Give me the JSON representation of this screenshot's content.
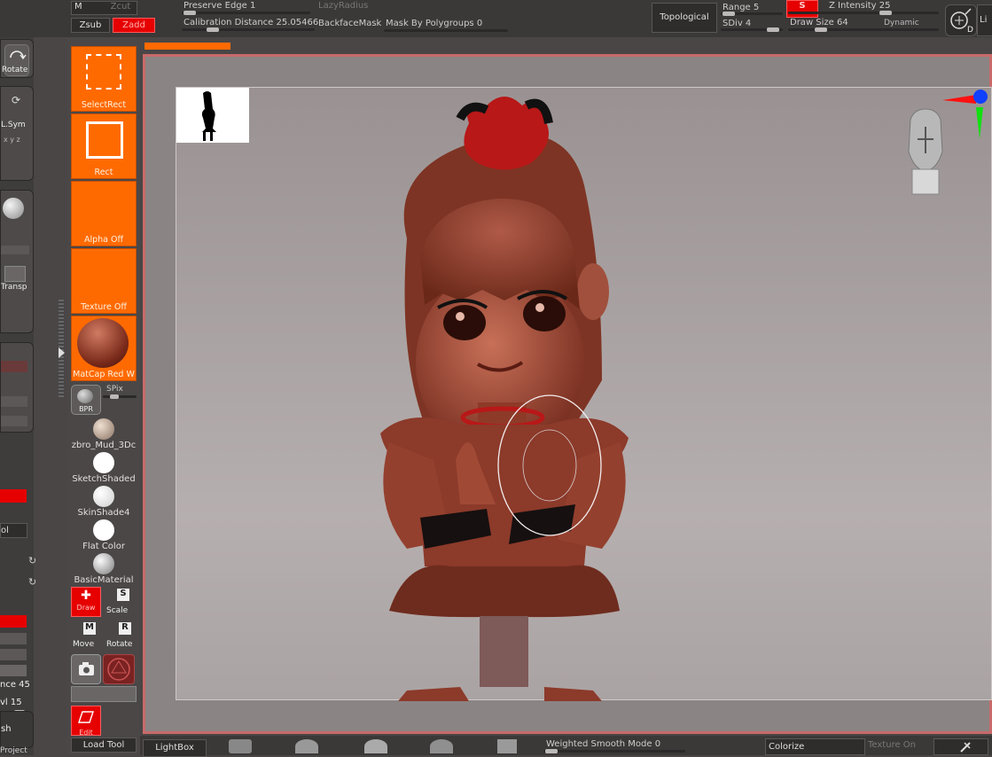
{
  "topbar": {
    "m_label": "M",
    "zcut_label": "Zcut",
    "zsub_label": "Zsub",
    "zadd_label": "Zadd",
    "preserve_edge": "Preserve Edge 1",
    "lazy_radius": "LazyRadius",
    "calibration_distance": "Calibration Distance 25.05466",
    "backface_mask": "BackfaceMask",
    "mask_by_polygroups": "Mask By Polygroups 0",
    "topological": "Topological",
    "range": "Range 5",
    "sdiv": "SDiv 4",
    "z_intensity": "Z Intensity 25",
    "draw_size": "Draw Size 64",
    "dynamic": "Dynamic",
    "live_label": "Li"
  },
  "left_edge": {
    "rotate": "Rotate",
    "lsym": "L.Sym",
    "transp": "Transp",
    "tool": "ol",
    "distance": "nce 45",
    "level": "vl 15",
    "brush": "sh",
    "project": "Project"
  },
  "shelf": {
    "select_rect": "SelectRect",
    "rect": "Rect",
    "alpha_off": "Alpha Off",
    "texture_off": "Texture Off",
    "matcap": "MatCap Red W",
    "bpr": "BPR",
    "spix": "SPix",
    "materials": [
      {
        "label": "zbro_Mud_3Dc",
        "color": "#b09a88"
      },
      {
        "label": "SketchShaded",
        "color": "#ffffff"
      },
      {
        "label": "SkinShade4",
        "color": "#f2f2f2"
      },
      {
        "label": "Flat Color",
        "color": "#ffffff"
      },
      {
        "label": "BasicMaterial",
        "color": "#d8d8d8"
      }
    ],
    "draw": "Draw",
    "scale": "Scale",
    "move": "Move",
    "rotate": "Rotate",
    "edit": "Edit",
    "load_tool": "Load Tool"
  },
  "bottombar": {
    "lightbox": "LightBox",
    "weighted_smooth": "Weighted Smooth Mode 0",
    "colorize": "Colorize",
    "texture_on": "Texture On"
  },
  "colors": {
    "accent": "#ff6a00",
    "active_red": "#e60000",
    "frame": "#c96a6a",
    "model": "#9c4a38"
  }
}
